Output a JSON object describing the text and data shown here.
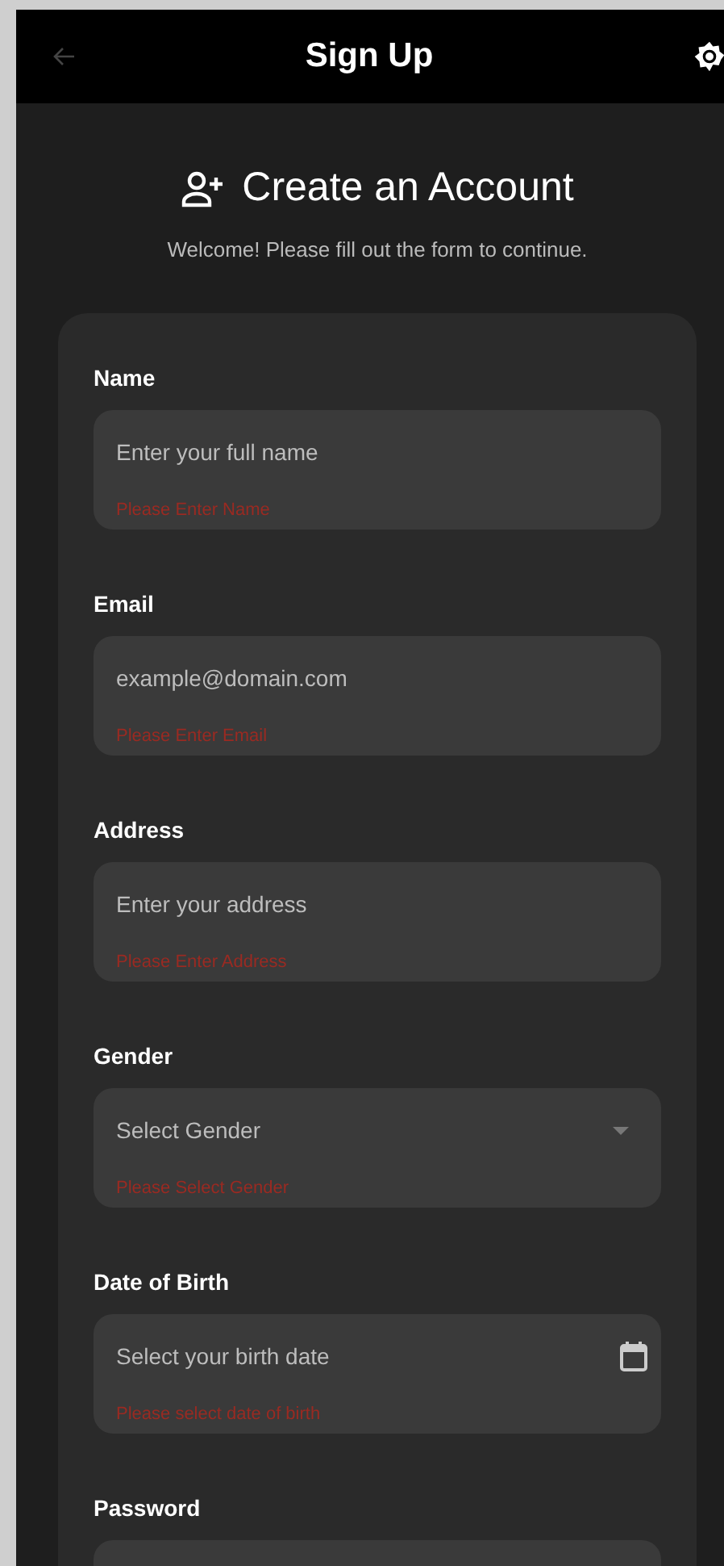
{
  "app_bar": {
    "title": "Sign Up",
    "back_disabled": true
  },
  "header": {
    "title": "Create an Account",
    "subtitle": "Welcome! Please fill out the form to continue."
  },
  "fields": [
    {
      "kind": "text",
      "label": "Name",
      "placeholder": "Enter your full name",
      "error": "Please Enter Name"
    },
    {
      "kind": "text",
      "label": "Email",
      "placeholder": "example@domain.com",
      "error": "Please Enter Email"
    },
    {
      "kind": "text",
      "label": "Address",
      "placeholder": "Enter your address",
      "error": "Please Enter Address"
    },
    {
      "kind": "select",
      "label": "Gender",
      "placeholder": "Select Gender",
      "error": "Please Select Gender"
    },
    {
      "kind": "date",
      "label": "Date of Birth",
      "placeholder": "Select your birth date",
      "error": "Please select date of birth"
    },
    {
      "kind": "password",
      "label": "Password"
    }
  ]
}
